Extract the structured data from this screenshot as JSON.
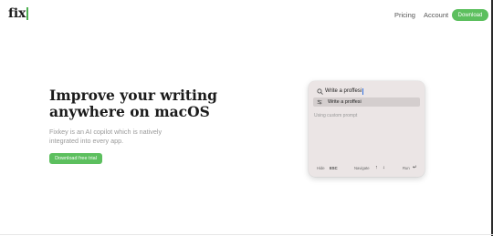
{
  "nav": {
    "logo": "fix",
    "links": [
      "Pricing",
      "Account"
    ],
    "download_label": "Download",
    "accent_color": "#5cbf5e"
  },
  "hero": {
    "title_line1": "Improve your writing",
    "title_line2": "anywhere on macOS",
    "subtitle_line1": "Fixkey is an AI copilot which is natively",
    "subtitle_line2": "integrated into every app.",
    "cta_label": "Download free trial"
  },
  "app_preview": {
    "search_value": "Write a proffesi",
    "search_icon": "search-icon",
    "suggestion_label": "Write a proffesi",
    "suggestion_icon": "sliders-icon",
    "custom_prompt": "Using custom prompt",
    "footer": {
      "hide_label": "Hide",
      "hide_key": "ESC",
      "navigate_label": "Navigate",
      "up_key": "↑",
      "down_key": "↓",
      "run_label": "Run",
      "run_key": "↵"
    }
  }
}
